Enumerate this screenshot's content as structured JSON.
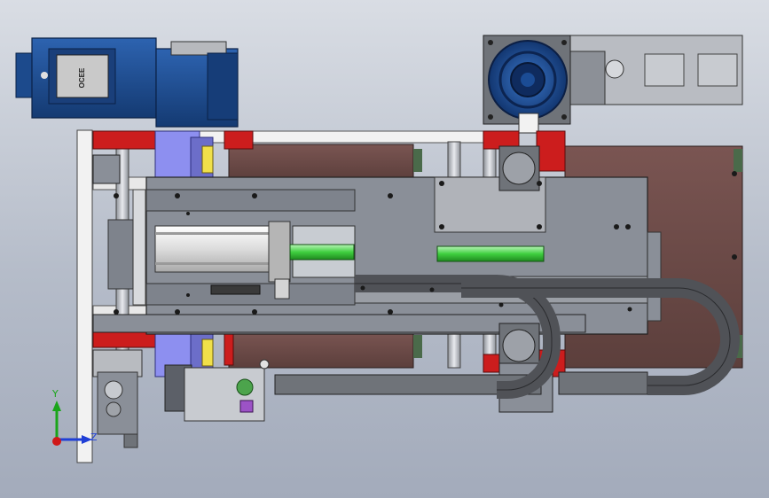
{
  "viewport": {
    "background_top": "#d9dde4",
    "background_bottom": "#a3abbb"
  },
  "triad": {
    "y_label": "Y",
    "z_label": "Z",
    "y_color": "#1aa51a",
    "z_color": "#1f3fd6",
    "x_color": "#d01818"
  },
  "gear_motor": {
    "label": "OCEE",
    "body_color": "#1c4a8c"
  },
  "servo_motor": {
    "body_color": "#e9e9e9"
  },
  "shaft": {
    "color": "#4cd34c"
  },
  "colors": {
    "plate": "#8a8f98",
    "dark_plate": "#5c6068",
    "rail_red": "#cc1d1d",
    "brown_panel": "#6b4a47",
    "block_blue": "#8d8ff0",
    "cable_chain": "#505257",
    "frame_white": "#f2f2f2"
  }
}
